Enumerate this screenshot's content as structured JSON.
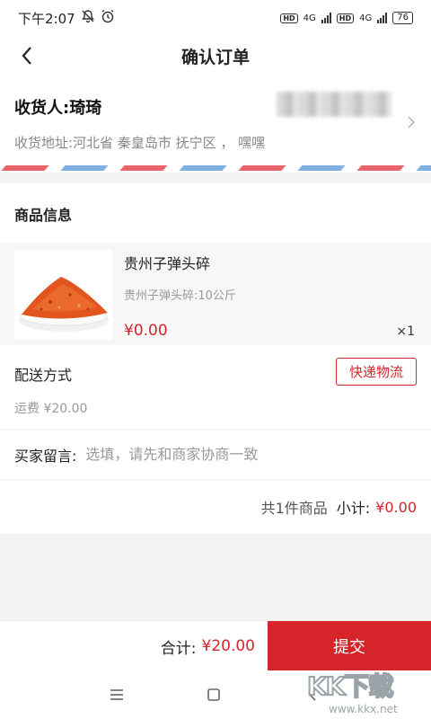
{
  "status_bar": {
    "time": "下午2:07",
    "alarm_icon": "alarm-clock-icon",
    "mute_icon": "bell-off-icon",
    "sim1_hd": "HD",
    "sim1_net": "4G",
    "sim2_hd": "HD",
    "sim2_net": "4G",
    "battery": "76"
  },
  "header": {
    "back_icon": "chevron-left-icon",
    "title": "确认订单"
  },
  "address": {
    "receiver": "收货人:琦琦",
    "address_line": "收货地址:河北省 秦皇岛市 抚宁区 ， 嘿嘿",
    "chevron_icon": "chevron-right-icon"
  },
  "goods": {
    "heading": "商品信息",
    "items": [
      {
        "name": "贵州子弹头碎",
        "spec": "贵州子弹头碎:10公斤",
        "price": "¥0.00",
        "qty": "×1"
      }
    ]
  },
  "delivery": {
    "label": "配送方式",
    "method_button": "快递物流",
    "freight": "运费 ¥20.00"
  },
  "message": {
    "label": "买家留言:",
    "placeholder": "选填，请先和商家协商一致"
  },
  "summary": {
    "count_text": "共1件商品",
    "subtotal_label": "小计:",
    "subtotal_value": "¥0.00"
  },
  "footer": {
    "total_label": "合计:",
    "total_value": "¥20.00",
    "submit_label": "提交"
  },
  "system_nav": {
    "menu_icon": "menu-icon",
    "home_icon": "home-square-icon",
    "back_icon": "back-triangle-icon"
  },
  "watermark": {
    "logo_text": "KK下载",
    "url": "www.kkx.net"
  },
  "colors": {
    "accent": "#d6242b",
    "stripe_red": "#e8666b",
    "stripe_blue": "#7fb1e0"
  }
}
